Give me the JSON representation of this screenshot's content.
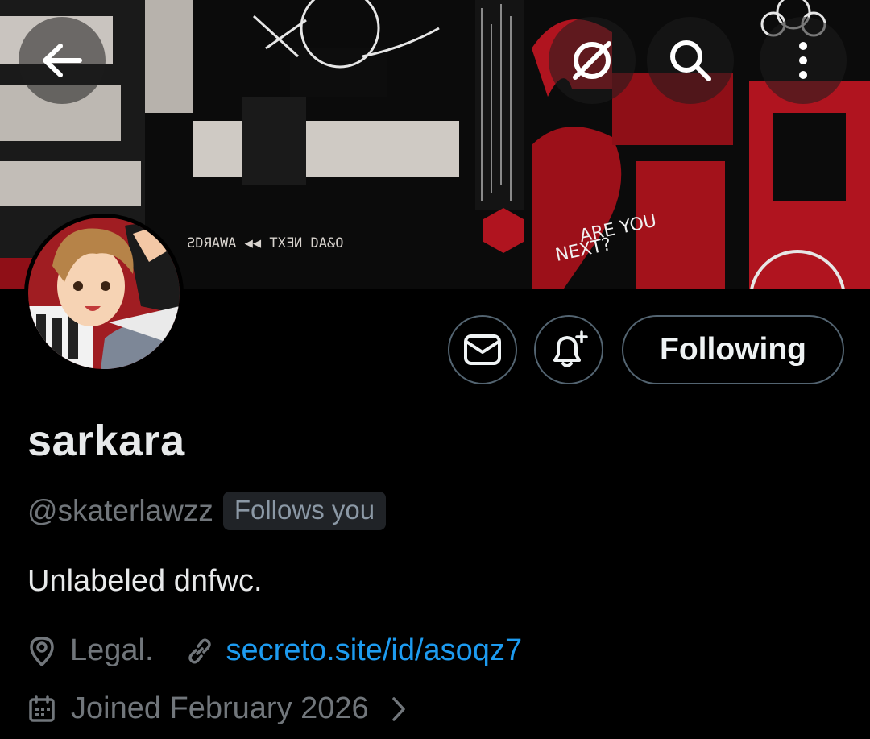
{
  "header": {
    "back_icon": "arrow-left-icon",
    "grok_icon": "grok-icon",
    "search_icon": "search-icon",
    "more_icon": "more-vertical-icon"
  },
  "banner": {
    "texts": {
      "left_arrow": "ƧDЯAWA",
      "award_line": "ƧDЯAWA ◀◀ TXƎИ DA&O",
      "are_you": "ARE YOU",
      "next": "NEXT?"
    },
    "colors": {
      "red": "#b0141f",
      "dark": "#0b0b0b",
      "light": "#d9d4cf"
    }
  },
  "actions": {
    "message_icon": "envelope-icon",
    "notify_icon": "bell-plus-icon",
    "following_label": "Following"
  },
  "profile": {
    "display_name": "sarkara",
    "handle": "@skaterlawzz",
    "follows_you": "Follows you",
    "bio": "Unlabeled dnfwc.",
    "location": "Legal.",
    "link": "secreto.site/id/asoqz7",
    "joined": "Joined February 2026"
  },
  "colors": {
    "accent": "#1d9bf0",
    "muted": "#71767b",
    "border": "#536471",
    "text": "#e7e9ea"
  }
}
